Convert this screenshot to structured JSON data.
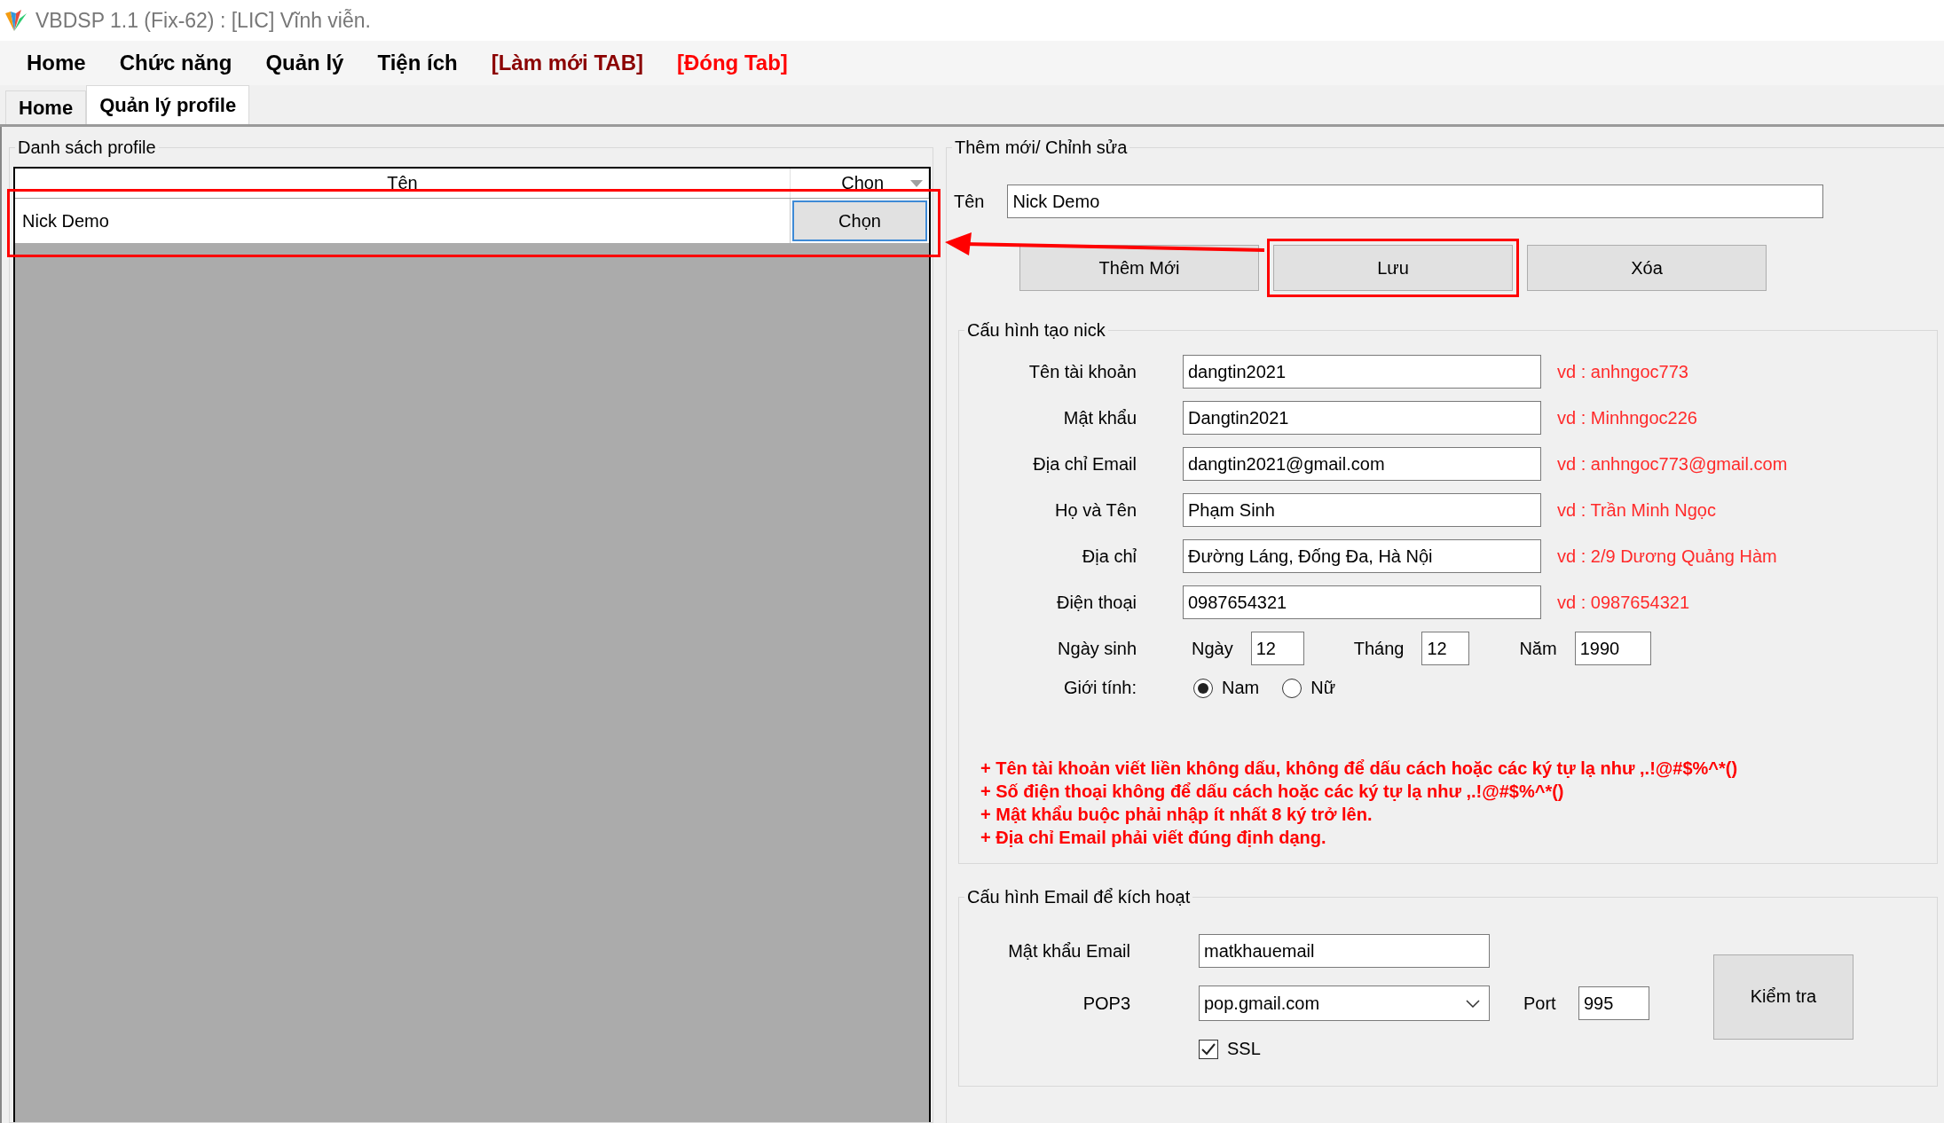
{
  "window": {
    "title": "VBDSP 1.1 (Fix-62) : [LIC] Vĩnh viễn."
  },
  "menu": [
    {
      "label": "Home",
      "color": "#000000"
    },
    {
      "label": "Chức năng",
      "color": "#000000"
    },
    {
      "label": "Quản lý",
      "color": "#000000"
    },
    {
      "label": "Tiện ích",
      "color": "#000000"
    },
    {
      "label": "[Làm mới TAB]",
      "color": "#8b0000"
    },
    {
      "label": "[Đóng Tab]",
      "color": "#ff0000"
    }
  ],
  "tabs": [
    {
      "label": "Home",
      "selected": false
    },
    {
      "label": "Quản lý profile",
      "selected": true
    }
  ],
  "profile_list": {
    "title": "Danh sách profile",
    "columns": [
      "Tên",
      "Chọn"
    ],
    "rows": [
      {
        "name": "Nick Demo",
        "button": "Chọn"
      }
    ]
  },
  "editor": {
    "title": "Thêm mới/ Chỉnh sửa",
    "name_label": "Tên",
    "name_value": "Nick Demo",
    "buttons": [
      {
        "label": "Thêm Mới",
        "highlighted": false
      },
      {
        "label": "Lưu",
        "highlighted": true
      },
      {
        "label": "Xóa",
        "highlighted": false
      }
    ]
  },
  "nick_config": {
    "title": "Cấu hình tạo nick",
    "fields": [
      {
        "label": "Tên tài khoản",
        "value": "dangtin2021",
        "hint": "vd : anhngoc773"
      },
      {
        "label": "Mật khẩu",
        "value": "Dangtin2021",
        "hint": "vd : Minhngoc226"
      },
      {
        "label": "Địa chỉ Email",
        "value": "dangtin2021@gmail.com",
        "hint": "vd : anhngoc773@gmail.com"
      },
      {
        "label": "Họ và Tên",
        "value": "Phạm Sinh",
        "hint": "vd : Trần Minh Ngọc"
      },
      {
        "label": "Địa chỉ",
        "value": "Đường Láng, Đống Đa, Hà Nội",
        "hint": "vd : 2/9 Dương Quảng Hàm"
      },
      {
        "label": "Điện thoại",
        "value": "0987654321",
        "hint": "vd : 0987654321"
      }
    ],
    "birth": {
      "label": "Ngày sinh",
      "parts": [
        {
          "label": "Ngày",
          "value": "12"
        },
        {
          "label": "Tháng",
          "value": "12"
        },
        {
          "label": "Năm",
          "value": "1990"
        }
      ]
    },
    "gender": {
      "label": "Giới tính:",
      "options": [
        {
          "label": "Nam",
          "selected": true
        },
        {
          "label": "Nữ",
          "selected": false
        }
      ]
    },
    "notes": [
      "+ Tên tài khoản viết liền không dấu, không để dấu cách hoặc các ký tự lạ như ,.!@#$%^*()",
      "+ Số điện thoại không để dấu cách hoặc các ký tự lạ như ,.!@#$%^*()",
      "+ Mật khẩu buộc phải nhập ít nhất 8 ký trở lên.",
      "+ Địa chỉ Email phải viết đúng định dạng."
    ]
  },
  "email_config": {
    "title": "Cấu hình Email để kích hoạt",
    "password_label": "Mật khẩu Email",
    "password_value": "matkhauemail",
    "pop3_label": "POP3",
    "pop3_value": "pop.gmail.com",
    "port_label": "Port",
    "port_value": "995",
    "check_button": "Kiểm tra",
    "ssl": {
      "label": "SSL",
      "checked": true
    }
  }
}
